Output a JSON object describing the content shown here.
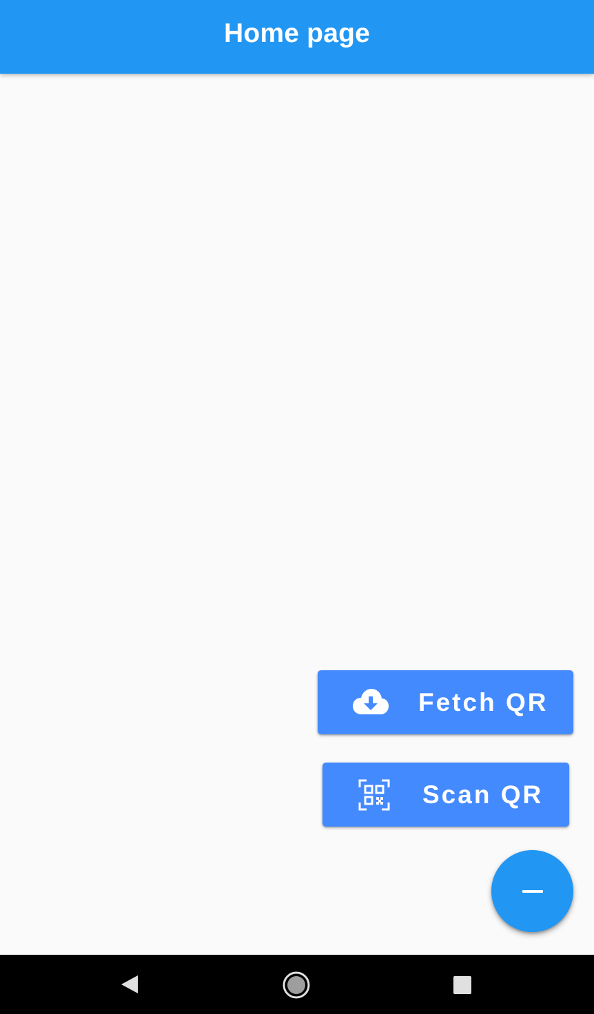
{
  "app_bar": {
    "title": "Home page",
    "color": "#2196f3"
  },
  "actions": {
    "fetch": {
      "label": "Fetch QR",
      "icon": "cloud-download-icon",
      "color": "#448aff"
    },
    "scan": {
      "label": "Scan QR",
      "icon": "qr-code-scanner-icon",
      "color": "#448aff"
    }
  },
  "fab": {
    "icon": "minus-icon",
    "color": "#2196f3"
  },
  "navigation": {
    "back_icon": "back-triangle-icon",
    "home_icon": "home-circle-icon",
    "recents_icon": "recents-square-icon"
  }
}
